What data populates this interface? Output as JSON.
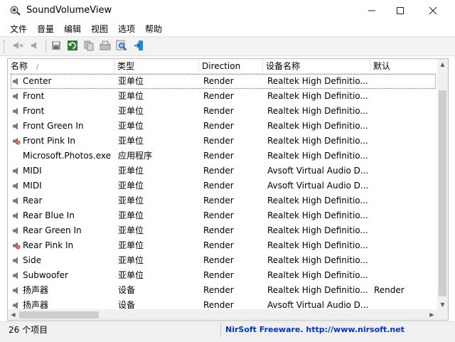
{
  "window": {
    "title": "SoundVolumeView"
  },
  "menu": [
    "文件",
    "音量",
    "编辑",
    "视图",
    "选项",
    "帮助"
  ],
  "toolbar": {
    "icons": [
      "mute-icon",
      "unmute-icon",
      "save-icon",
      "refresh-icon",
      "copy-icon",
      "properties-icon",
      "find-icon",
      "exit-icon"
    ]
  },
  "columns": [
    "名称",
    "类型",
    "Direction",
    "设备名称",
    "默认"
  ],
  "rows": [
    {
      "name": "Center",
      "type": "亚单位",
      "direction": "Render",
      "device": "Realtek High Definitio...",
      "default": "",
      "icon": "speaker-icon",
      "selected": true
    },
    {
      "name": "Front",
      "type": "亚单位",
      "direction": "Render",
      "device": "Realtek High Definitio...",
      "default": "",
      "icon": "speaker-icon"
    },
    {
      "name": "Front",
      "type": "亚单位",
      "direction": "Render",
      "device": "Realtek High Definitio...",
      "default": "",
      "icon": "speaker-icon"
    },
    {
      "name": "Front Green In",
      "type": "亚单位",
      "direction": "Render",
      "device": "Realtek High Definitio...",
      "default": "",
      "icon": "speaker-icon"
    },
    {
      "name": "Front Pink In",
      "type": "亚单位",
      "direction": "Render",
      "device": "Realtek High Definitio...",
      "default": "",
      "icon": "muted-speaker-icon"
    },
    {
      "name": "Microsoft.Photos.exe",
      "type": "应用程序",
      "direction": "Render",
      "device": "Realtek High Definitio...",
      "default": "",
      "icon": ""
    },
    {
      "name": "MIDI",
      "type": "亚单位",
      "direction": "Render",
      "device": "Avsoft Virtual Audio D...",
      "default": "",
      "icon": "speaker-icon"
    },
    {
      "name": "MIDI",
      "type": "亚单位",
      "direction": "Render",
      "device": "Avsoft Virtual Audio D...",
      "default": "",
      "icon": "speaker-icon"
    },
    {
      "name": "Rear",
      "type": "亚单位",
      "direction": "Render",
      "device": "Realtek High Definitio...",
      "default": "",
      "icon": "speaker-icon"
    },
    {
      "name": "Rear Blue In",
      "type": "亚单位",
      "direction": "Render",
      "device": "Realtek High Definitio...",
      "default": "",
      "icon": "speaker-icon"
    },
    {
      "name": "Rear Green In",
      "type": "亚单位",
      "direction": "Render",
      "device": "Realtek High Definitio...",
      "default": "",
      "icon": "speaker-icon"
    },
    {
      "name": "Rear Pink In",
      "type": "亚单位",
      "direction": "Render",
      "device": "Realtek High Definitio...",
      "default": "",
      "icon": "muted-speaker-icon"
    },
    {
      "name": "Side",
      "type": "亚单位",
      "direction": "Render",
      "device": "Realtek High Definitio...",
      "default": "",
      "icon": "speaker-icon"
    },
    {
      "name": "Subwoofer",
      "type": "亚单位",
      "direction": "Render",
      "device": "Realtek High Definitio...",
      "default": "",
      "icon": "speaker-icon"
    },
    {
      "name": "扬声器",
      "type": "设备",
      "direction": "Render",
      "device": "Realtek High Definitio...",
      "default": "Render",
      "icon": "speaker-icon"
    },
    {
      "name": "扬声器",
      "type": "设备",
      "direction": "Render",
      "device": "Avsoft Virtual Audio D...",
      "default": "",
      "icon": "speaker-icon"
    }
  ],
  "status": {
    "count": "26 个项目",
    "link": "NirSoft Freeware.  http://www.nirsoft.net"
  }
}
